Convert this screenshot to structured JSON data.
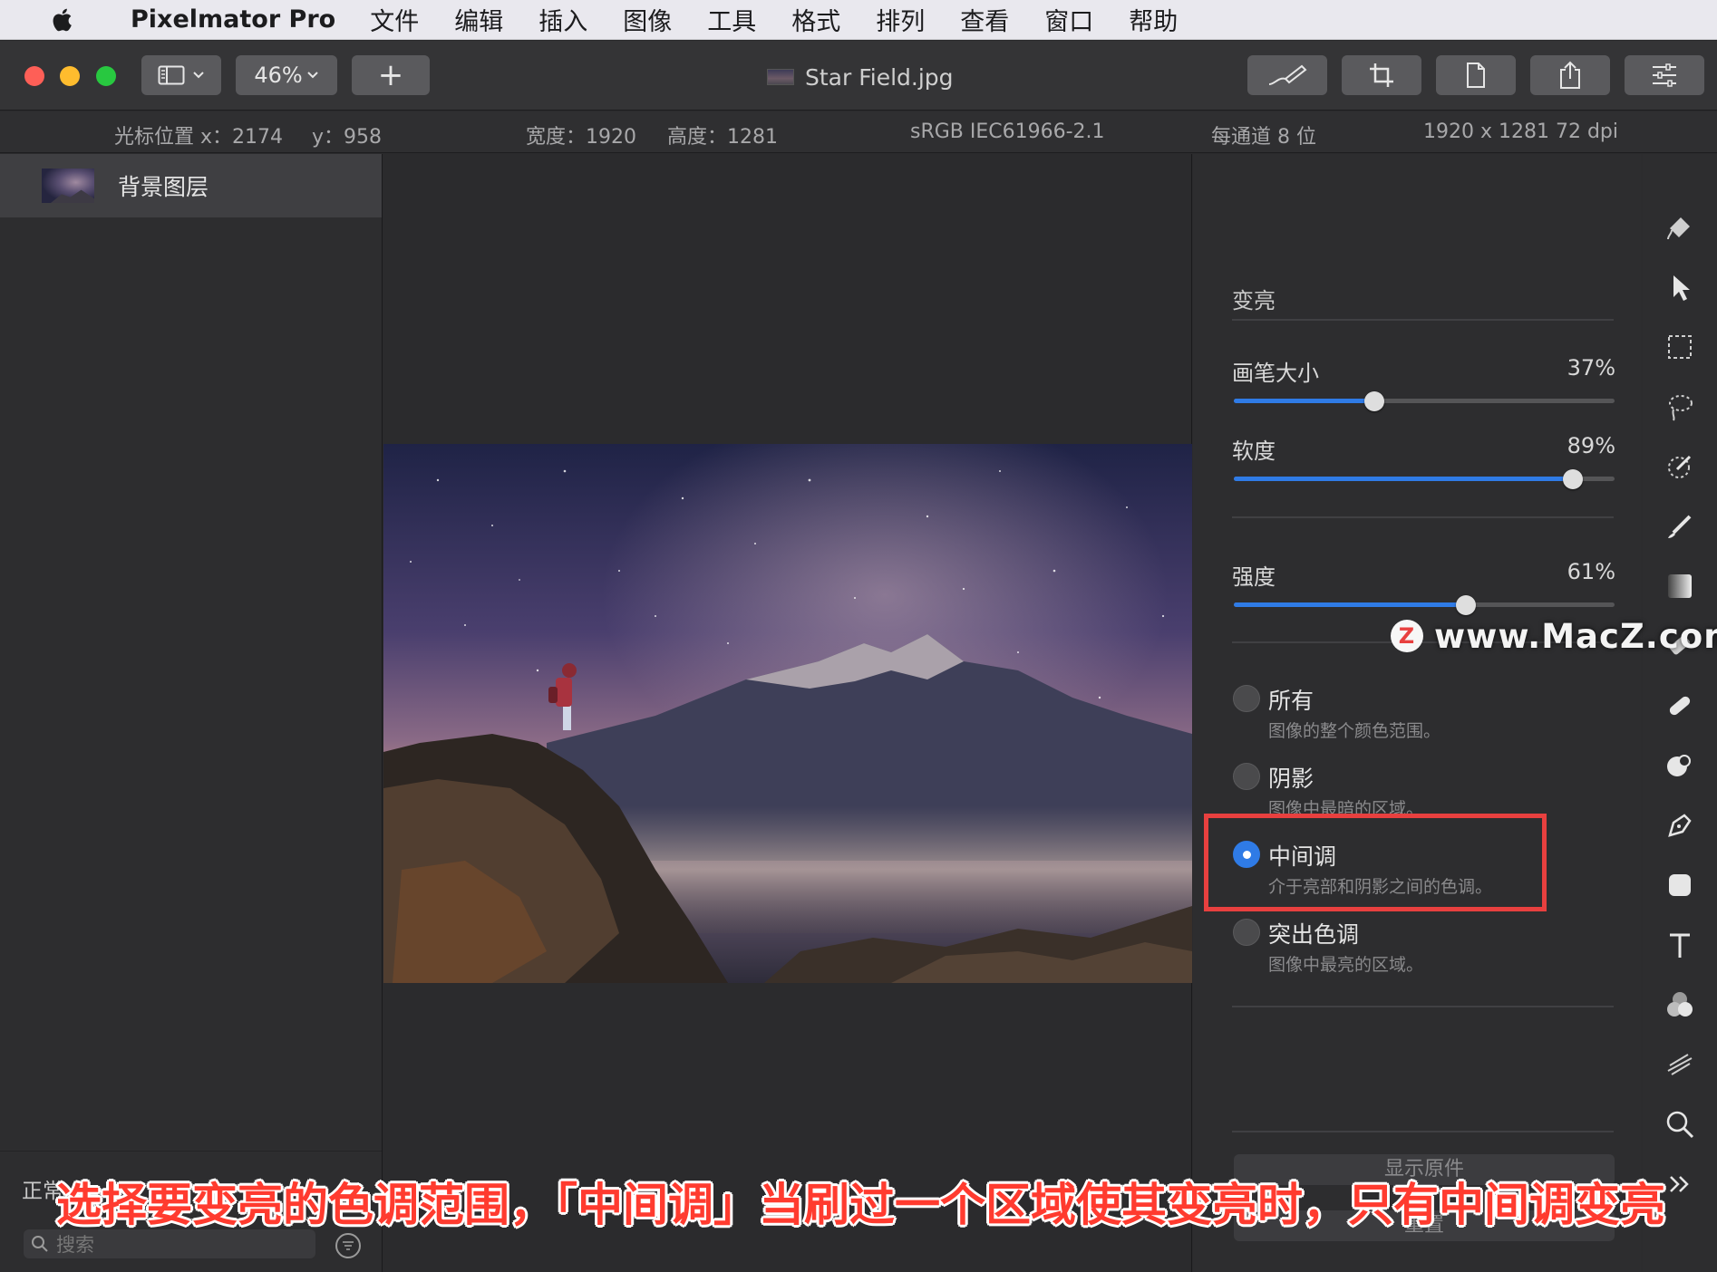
{
  "menubar": {
    "app_name": "Pixelmator Pro",
    "items": [
      "文件",
      "编辑",
      "插入",
      "图像",
      "工具",
      "格式",
      "排列",
      "查看",
      "窗口",
      "帮助"
    ]
  },
  "toolbar": {
    "zoom": "46%",
    "add_label": "+",
    "document_title": "Star Field.jpg"
  },
  "infobar": {
    "cursor_x": "光标位置 x：2174",
    "cursor_y": "y：958",
    "width": "宽度：1920",
    "height": "高度：1281",
    "color_profile": "sRGB IEC61966-2.1",
    "bit_depth": "每通道 8 位",
    "dimensions": "1920 x 1281 72 dpi"
  },
  "layers": {
    "items": [
      {
        "name": "背景图层"
      }
    ],
    "blend_mode": "正常",
    "search_placeholder": "搜索"
  },
  "options": {
    "title": "变亮",
    "brush_size": {
      "label": "画笔大小",
      "value": "37%",
      "fraction": 0.37
    },
    "softness": {
      "label": "软度",
      "value": "89%",
      "fraction": 0.89
    },
    "strength": {
      "label": "强度",
      "value": "61%",
      "fraction": 0.61
    },
    "ranges": [
      {
        "title": "所有",
        "desc": "图像的整个颜色范围。",
        "selected": false
      },
      {
        "title": "阴影",
        "desc": "图像中最暗的区域。",
        "selected": false
      },
      {
        "title": "中间调",
        "desc": "介于亮部和阴影之间的色调。",
        "selected": true
      },
      {
        "title": "突出色调",
        "desc": "图像中最亮的区域。",
        "selected": false
      }
    ],
    "show_original": "显示原件",
    "reset": "重置"
  },
  "tools": [
    "paint-bucket-icon",
    "arrow-icon",
    "rect-select-icon",
    "lasso-icon",
    "color-select-icon",
    "brush-icon",
    "gradient-icon",
    "eraser-icon",
    "repair-icon",
    "clone-icon",
    "pen-icon",
    "shape-icon",
    "text-icon",
    "color-adjust-icon",
    "distort-icon",
    "zoom-icon",
    "more-icon"
  ],
  "watermark": {
    "logo": "Z",
    "text": "www.MacZ.com"
  },
  "caption": "选择要变亮的色调范围，「中间调」当刷过一个区域使其变亮时，只有中间调变亮",
  "colors": {
    "accent": "#2f7be6",
    "highlight": "#e8403f"
  }
}
